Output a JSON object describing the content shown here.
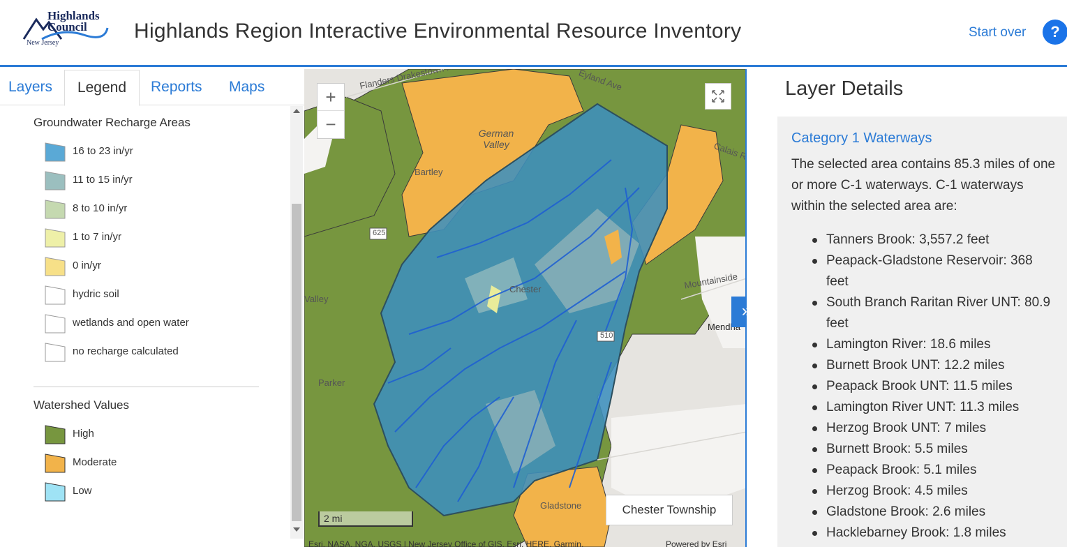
{
  "header": {
    "logo_line1": "Highlands",
    "logo_line2": "Council",
    "logo_line3": "New Jersey",
    "title": "Highlands Region Interactive Environmental Resource Inventory",
    "start_over": "Start over",
    "help": "?"
  },
  "tabs": [
    {
      "label": "Layers",
      "active": false
    },
    {
      "label": "Legend",
      "active": true
    },
    {
      "label": "Reports",
      "active": false
    },
    {
      "label": "Maps",
      "active": false
    }
  ],
  "legend": {
    "groups": [
      {
        "title": "Groundwater Recharge Areas",
        "items": [
          {
            "label": "16 to 23 in/yr",
            "color": "#5aa9d6"
          },
          {
            "label": "11 to 15 in/yr",
            "color": "#9bbfbf"
          },
          {
            "label": "8 to 10 in/yr",
            "color": "#c5d9b0"
          },
          {
            "label": "1 to 7 in/yr",
            "color": "#eef0a8"
          },
          {
            "label": "0 in/yr",
            "color": "#f7e088"
          },
          {
            "label": "hydric soil",
            "color": "#ffffff"
          },
          {
            "label": "wetlands and open water",
            "color": "#ffffff"
          },
          {
            "label": "no recharge calculated",
            "color": "#ffffff"
          }
        ]
      },
      {
        "title": "Watershed Values",
        "items": [
          {
            "label": "High",
            "color": "#77963f"
          },
          {
            "label": "Moderate",
            "color": "#f2b34a"
          },
          {
            "label": "Low",
            "color": "#9fe3f5"
          }
        ]
      }
    ]
  },
  "map": {
    "zoom_in": "+",
    "zoom_out": "−",
    "scale": "2 mi",
    "popup": "Chester Township",
    "attribution": "Esri, NASA, NGA, USGS | New Jersey Office of GIS, Esri, HERE, Garmin,",
    "powered": "Powered by Esri",
    "labels": {
      "german_valley": "German\nValley",
      "bartley": "Bartley",
      "chester": "Chester",
      "valley": "Valley",
      "parker": "Parker",
      "gladstone": "Gladstone",
      "mendham": "Mendha",
      "flanders": "Flanders Drakestown Rd",
      "eyland": "Eyland Ave",
      "mountainside": "Mountainside",
      "route625": "625",
      "route510": "510",
      "calais": "Calais R"
    },
    "colors": {
      "high": "#77963f",
      "moderate": "#f2b34a",
      "recharge": "#3d8fbd",
      "stream": "#1f5fd1"
    }
  },
  "collapse_icon": "»",
  "layer_details": {
    "title": "Layer Details",
    "link": "Category 1 Waterways",
    "description": "The selected area contains 85.3 miles of one or more C-1 waterways. C-1 waterways within the selected area are:",
    "waterways": [
      "Tanners Brook: 3,557.2 feet",
      "Peapack-Gladstone Reservoir: 368 feet",
      "South Branch Raritan River UNT: 80.9 feet",
      "Lamington River: 18.6 miles",
      "Burnett Brook UNT: 12.2 miles",
      "Peapack Brook UNT: 11.5 miles",
      "Lamington River UNT: 11.3 miles",
      "Herzog Brook UNT: 7 miles",
      "Burnett Brook: 5.5 miles",
      "Peapack Brook: 5.1 miles",
      "Herzog Brook: 4.5 miles",
      "Gladstone Brook: 2.6 miles",
      "Hacklebarney Brook: 1.8 miles"
    ]
  }
}
